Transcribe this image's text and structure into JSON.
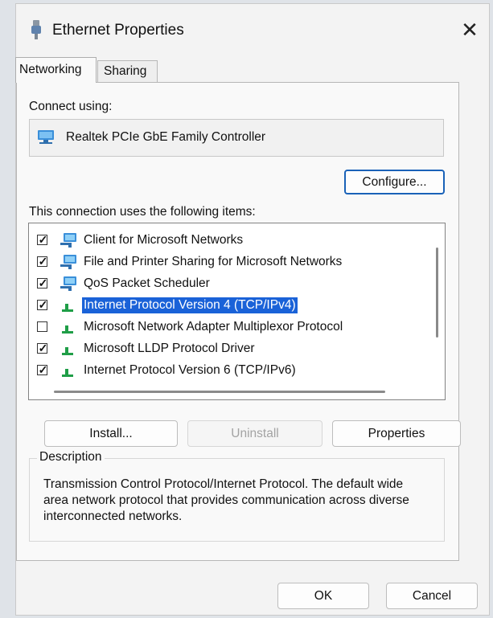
{
  "window": {
    "title": "Ethernet Properties",
    "icon": "ethernet-plug-icon",
    "close_label": "✕"
  },
  "tabs": [
    {
      "label": "Networking",
      "active": true
    },
    {
      "label": "Sharing",
      "active": false
    }
  ],
  "connect_using": {
    "label": "Connect using:",
    "adapter_name": "Realtek PCIe GbE Family Controller",
    "adapter_icon": "network-adapter-icon",
    "configure_label": "Configure..."
  },
  "items": {
    "label": "This connection uses the following items:",
    "list": [
      {
        "label": "Client for Microsoft Networks",
        "checked": true,
        "icon": "network-client-icon",
        "selected": false
      },
      {
        "label": "File and Printer Sharing for Microsoft Networks",
        "checked": true,
        "icon": "network-service-icon",
        "selected": false
      },
      {
        "label": "QoS Packet Scheduler",
        "checked": true,
        "icon": "network-service-icon",
        "selected": false
      },
      {
        "label": "Internet Protocol Version 4 (TCP/IPv4)",
        "checked": true,
        "icon": "protocol-icon",
        "selected": true
      },
      {
        "label": "Microsoft Network Adapter Multiplexor Protocol",
        "checked": false,
        "icon": "protocol-icon",
        "selected": false
      },
      {
        "label": "Microsoft LLDP Protocol Driver",
        "checked": true,
        "icon": "protocol-icon",
        "selected": false
      },
      {
        "label": "Internet Protocol Version 6 (TCP/IPv6)",
        "checked": true,
        "icon": "protocol-icon",
        "selected": false
      }
    ]
  },
  "buttons": {
    "install": "Install...",
    "uninstall": "Uninstall",
    "properties": "Properties",
    "ok": "OK",
    "cancel": "Cancel"
  },
  "description": {
    "legend": "Description",
    "text": "Transmission Control Protocol/Internet Protocol. The default wide area network protocol that provides communication across diverse interconnected networks."
  },
  "colors": {
    "selection": "#1a62d8",
    "default_button_border": "#1a62b8",
    "protocol_icon": "#1f9e47",
    "monitor_icon": "#3a8fd9"
  }
}
